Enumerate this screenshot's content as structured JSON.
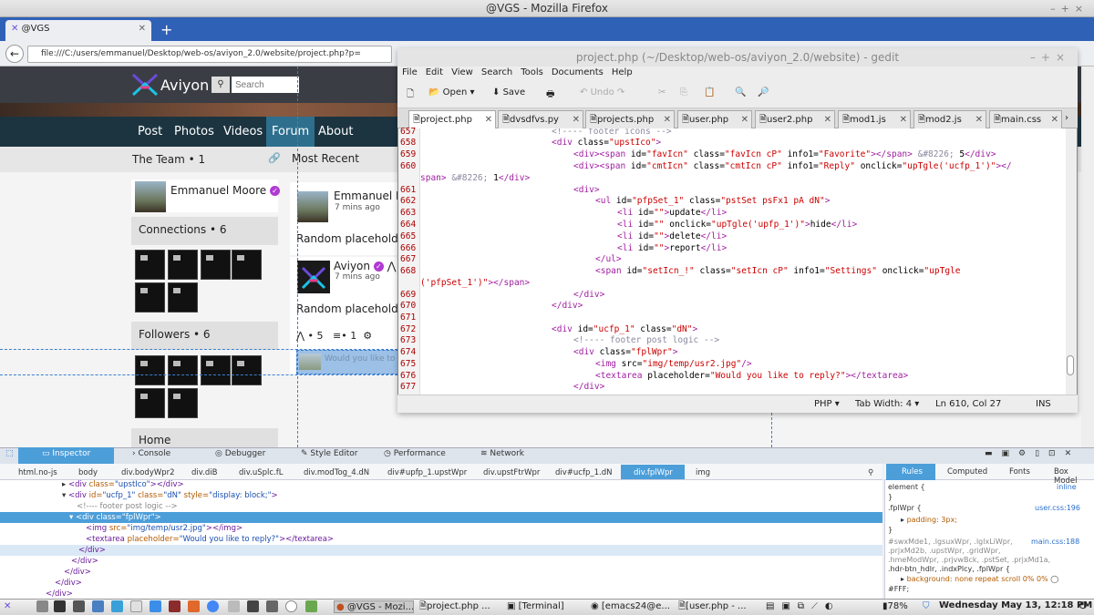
{
  "firefox": {
    "title": "@VGS - Mozilla Firefox",
    "tab_label": "@VGS",
    "url": "file:///C:/users/emmanuel/Desktop/web-os/aviyon_2.0/website/project.php?p="
  },
  "site": {
    "brand": "Aviyon",
    "search_placeholder": "Search",
    "nav": [
      "Post",
      "Photos",
      "Videos",
      "Forum",
      "About"
    ],
    "team_label": "The Team • 1",
    "most_recent": "Most Recent",
    "user_name": "Emmanuel Moore",
    "connections": "Connections • 6",
    "followers": "Followers • 6",
    "home": "Home",
    "post1": {
      "author": "Emmanuel M",
      "time": "7 mins ago",
      "text": "Random placeholde"
    },
    "post2": {
      "author": "Aviyon",
      "time": "7 mins ago",
      "text": "Random placeholde",
      "likes": "• 5",
      "comments": "• 1",
      "reply_placeholder": "Would you like to"
    }
  },
  "gedit": {
    "title": "project.php (~/Desktop/web-os/aviyon_2.0/website) - gedit",
    "menu": [
      "File",
      "Edit",
      "View",
      "Search",
      "Tools",
      "Documents",
      "Help"
    ],
    "toolbar": {
      "open": "Open",
      "save": "Save",
      "undo": "Undo"
    },
    "tabs": [
      "project.php",
      "dvsdfvs.py",
      "projects.php",
      "user.php",
      "user2.php",
      "mod1.js",
      "mod2.js",
      "main.css"
    ],
    "line_numbers": [
      "657",
      "658",
      "659",
      "660",
      "",
      "661",
      "662",
      "663",
      "664",
      "665",
      "666",
      "667",
      "668",
      "",
      "669",
      "670",
      "671",
      "672",
      "673",
      "674",
      "675",
      "676",
      "677"
    ],
    "status": {
      "lang": "PHP",
      "tab_width": "Tab Width: 4",
      "pos": "Ln 610, Col 27",
      "mode": "INS"
    }
  },
  "devtools": {
    "tabs": [
      "Inspector",
      "Console",
      "Debugger",
      "Style Editor",
      "Performance",
      "Network"
    ],
    "crumbs": [
      "html.no-js",
      "body",
      "div.bodyWpr2",
      "div.diB",
      "div.uSplc.fL",
      "div.modTog_4.dN",
      "div#upfp_1.upstWpr",
      "div.upstFtrWpr",
      "div#ucfp_1.dN",
      "div.fplWpr",
      "img"
    ],
    "side_tabs": [
      "Rules",
      "Computed",
      "Fonts",
      "Box Model"
    ],
    "rules": {
      "element": "element {",
      "inline": "inline",
      "fpl": ".fplWpr {",
      "src1": "user.css:196",
      "padding": "padding: 3px;",
      "close": "}",
      "multi": "#swxMde1, .lgsuxWpr, .lglxLiWpr,",
      "multi2": ".prjxMd2b, .upstWpr, .gridWpr,",
      "multi3": ".hmeModWpr, .prjvwBck, .pstSet, .prjxMd1a,",
      "multi4": ".hdr-btn_hdlr, .indxPlcy, .fplWpr {",
      "src2": "main.css:188",
      "bg": "background: none repeat scroll 0% 0%",
      "bg2": "#FFF;"
    }
  },
  "taskbar": {
    "items": [
      "@VGS - Mozi...",
      "project.php ...",
      "[Terminal]",
      "[emacs24@e...",
      "[user.php - ..."
    ],
    "battery": "78%",
    "clock": "Wednesday May 13, 12:18 PM"
  }
}
